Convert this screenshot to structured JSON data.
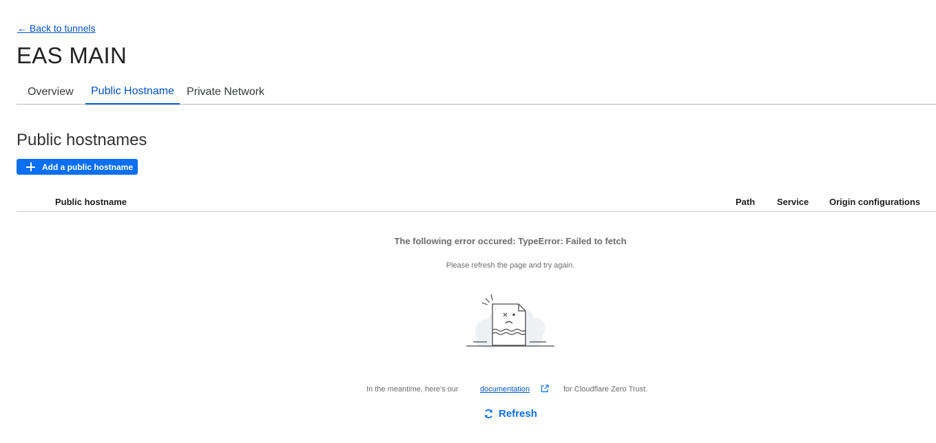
{
  "nav": {
    "back_link": "← Back to tunnels"
  },
  "page": {
    "title": "EAS MAIN"
  },
  "tabs": [
    {
      "label": "Overview",
      "active": false
    },
    {
      "label": "Public Hostname",
      "active": true
    },
    {
      "label": "Private Network",
      "active": false
    }
  ],
  "section": {
    "title": "Public hostnames",
    "add_button_label": "Add a public hostname"
  },
  "table": {
    "columns": [
      "Public hostname",
      "Path",
      "Service",
      "Origin configurations"
    ]
  },
  "error": {
    "title": "The following error occured: TypeError: Failed to fetch",
    "subtitle": "Please refresh the page and try again.",
    "meantime_prefix": "In the meantime, here's our",
    "documentation_link": "documentation",
    "meantime_suffix": "for Cloudflare Zero Trust.",
    "refresh_label": "Refresh"
  },
  "icons": {
    "add": "plus-icon",
    "illustration": "broken-document-icon",
    "external": "external-link-icon",
    "refresh": "refresh-icon"
  },
  "colors": {
    "accent": "#0a6ff2",
    "link": "#0051c3",
    "muted_text": "#6b6b6b"
  }
}
